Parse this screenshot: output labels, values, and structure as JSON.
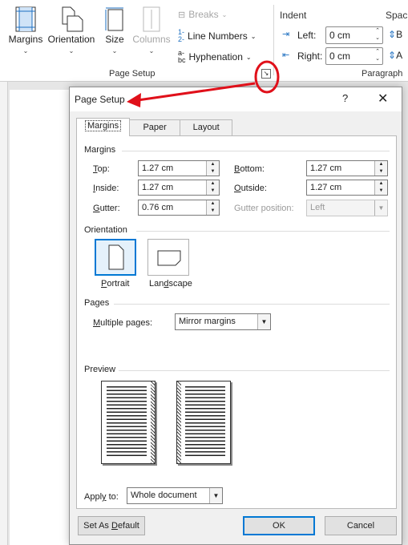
{
  "ribbon": {
    "buttons": {
      "margins": "Margins",
      "orientation": "Orientation",
      "size": "Size",
      "columns": "Columns"
    },
    "small": {
      "breaks": "Breaks",
      "line_numbers": "Line Numbers",
      "hyphenation": "Hyphenation"
    },
    "group_page_setup": "Page Setup",
    "paragraph": {
      "indent_header": "Indent",
      "spacing_header": "Spaci",
      "left_label": "Left:",
      "left_value": "0 cm",
      "right_label": "Right:",
      "right_value": "0 cm",
      "group_label": "Paragraph",
      "spacing_before_letter": "B",
      "spacing_after_letter": "A"
    }
  },
  "dialog": {
    "title": "Page Setup",
    "help": "?",
    "close": "✕",
    "tabs": [
      "Margins",
      "Paper",
      "Layout"
    ],
    "active_tab": "Margins",
    "margins_section": "Margins",
    "fields": {
      "top": {
        "label": "Top:",
        "value": "1.27 cm"
      },
      "inside": {
        "label": "Inside:",
        "value": "1.27 cm"
      },
      "gutter": {
        "label": "Gutter:",
        "value": "0.76 cm"
      },
      "bottom": {
        "label": "Bottom:",
        "value": "1.27 cm"
      },
      "outside": {
        "label": "Outside:",
        "value": "1.27 cm"
      },
      "gutter_position": {
        "label": "Gutter position:",
        "value": "Left"
      }
    },
    "orientation_section": "Orientation",
    "orientation": {
      "portrait": "Portrait",
      "landscape": "Landscape",
      "selected": "Portrait"
    },
    "pages_section": "Pages",
    "multiple_pages_label": "Multiple pages:",
    "multiple_pages_value": "Mirror margins",
    "preview_section": "Preview",
    "apply_to_label": "Apply to:",
    "apply_to_value": "Whole document",
    "buttons": {
      "set_default": "Set As Default",
      "ok": "OK",
      "cancel": "Cancel"
    }
  },
  "colors": {
    "accent": "#0078d4",
    "annotation": "#e0101a"
  }
}
